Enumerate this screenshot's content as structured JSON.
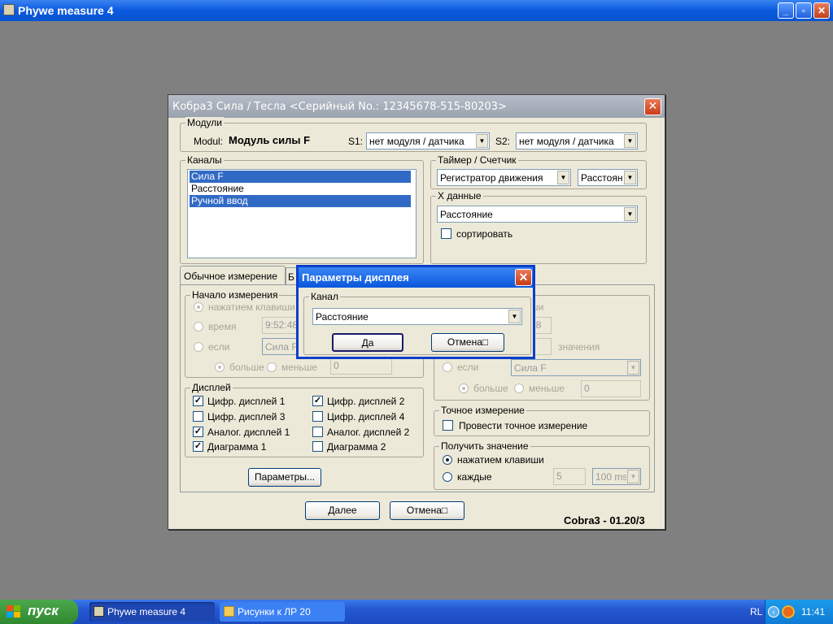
{
  "window": {
    "title": "Phywe measure 4",
    "min": "_",
    "max": "▫",
    "close": "✕"
  },
  "dialog": {
    "title": "Кобра3 Сила / Тесла  <Серийный No.: 12345678-515-80203>",
    "close": "✕",
    "modules": {
      "legend": "Модули",
      "modul_label": "Modul:",
      "modul_value": "Модуль силы F",
      "s1_label": "S1:",
      "s1_value": "нет модуля / датчика",
      "s2_label": "S2:",
      "s2_value": "нет модуля / датчика"
    },
    "channels": {
      "legend": "Каналы",
      "items": [
        {
          "label": "Сила F",
          "selected": true
        },
        {
          "label": "Расстояние",
          "selected": false
        },
        {
          "label": "Ручной ввод",
          "selected": true
        }
      ]
    },
    "timer": {
      "legend": "Таймер / Счетчик",
      "mode": "Регистратор движения",
      "unit": "Расстоян"
    },
    "xdata": {
      "legend": "X данные",
      "value": "Расстояние",
      "sort_label": "сортировать",
      "sort_checked": false
    },
    "tabs": {
      "tab1": "Обычное измерение",
      "tab2_partial": "Б"
    },
    "start": {
      "legend": "Начало измерения",
      "key_press": "нажатием клавиши",
      "time": "время",
      "time_value": "9:52:48",
      "if": "если",
      "if_value": "Сила F",
      "greater": "больше",
      "less": "меньше",
      "threshold": "0"
    },
    "stop": {
      "partial_label": "ши",
      "time_value": "48",
      "values_label": "значения",
      "if": "если",
      "if_value": "Сила F",
      "greater": "больше",
      "less": "меньше",
      "threshold": "0"
    },
    "display": {
      "legend": "Дисплей",
      "items": [
        {
          "label": "Цифр. дисплей 1",
          "checked": true
        },
        {
          "label": "Цифр. дисплей 2",
          "checked": true
        },
        {
          "label": "Цифр. дисплей 3",
          "checked": false
        },
        {
          "label": "Цифр. дисплей 4",
          "checked": false
        },
        {
          "label": "Аналог. дисплей 1",
          "checked": true
        },
        {
          "label": "Аналог. дисплей 2",
          "checked": false
        },
        {
          "label": "Диаграмма 1",
          "checked": true
        },
        {
          "label": "Диаграмма 2",
          "checked": false
        }
      ]
    },
    "precise": {
      "legend": "Точное измерение",
      "label": "Провести точное измерение",
      "checked": false
    },
    "getvalue": {
      "legend": "Получить значение",
      "key_press": "нажатием клавиши",
      "every": "каждые",
      "every_value": "5",
      "unit": "100 ms"
    },
    "params_button": "Параметры...",
    "next_button": "Далее",
    "cancel_button": "Отмена□",
    "version": "Cobra3 - 01.20/3"
  },
  "popup": {
    "title": "Параметры дисплея",
    "close": "✕",
    "channel_legend": "Канал",
    "channel_value": "Расстояние",
    "ok": "Да",
    "cancel": "Отмена□"
  },
  "taskbar": {
    "start": "пуск",
    "items": [
      "Phywe measure 4",
      "Рисунки к ЛР 20"
    ],
    "lang": "RL",
    "clock": "11:41"
  },
  "colors": {
    "selection": "#316ac5",
    "title_blue": "#0a56dc",
    "start_green": "#3a9a3a"
  }
}
